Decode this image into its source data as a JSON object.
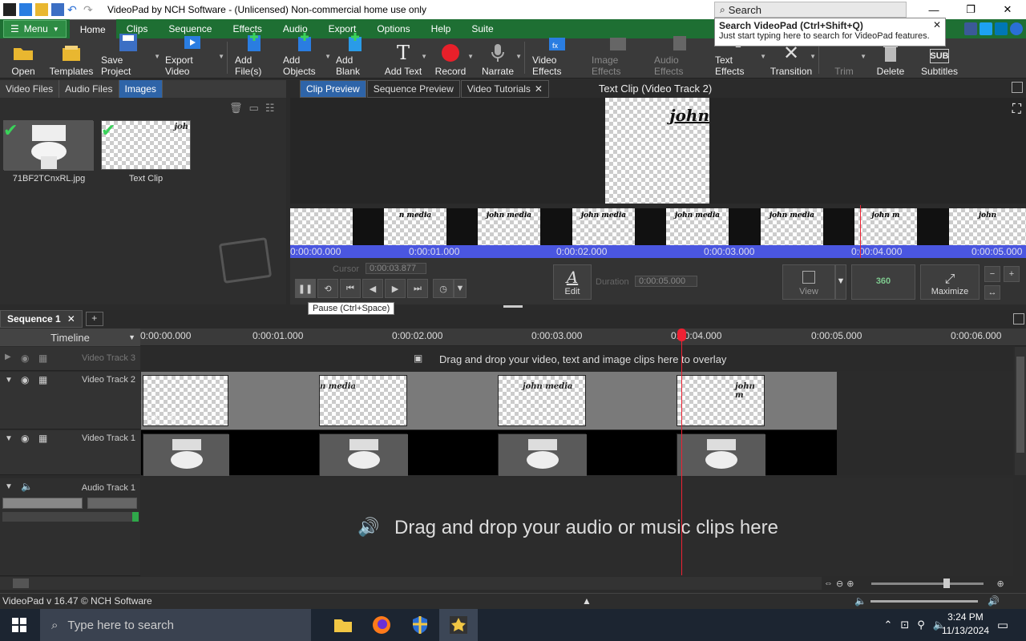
{
  "window": {
    "title": "VideoPad by NCH Software - (Unlicensed) Non-commercial home use only"
  },
  "search": {
    "label": "Search",
    "tip_title": "Search VideoPad (Ctrl+Shift+Q)",
    "tip_text": "Just start typing here to search for VideoPad features."
  },
  "menu": {
    "menu_label": "Menu",
    "tabs": [
      "Home",
      "Clips",
      "Sequence",
      "Effects",
      "Audio",
      "Export",
      "Options",
      "Help",
      "Suite"
    ]
  },
  "ribbon": {
    "open": "Open",
    "templates": "Templates",
    "save_project": "Save Project",
    "export_video": "Export Video",
    "add_files": "Add File(s)",
    "add_objects": "Add Objects",
    "add_blank": "Add Blank",
    "add_text": "Add Text",
    "record": "Record",
    "narrate": "Narrate",
    "video_effects": "Video Effects",
    "image_effects": "Image Effects",
    "audio_effects": "Audio Effects",
    "text_effects": "Text Effects",
    "transition": "Transition",
    "trim": "Trim",
    "delete": "Delete",
    "subtitles": "Subtitles"
  },
  "bins": {
    "tabs": [
      "Video Files",
      "Audio Files",
      "Images"
    ],
    "items": [
      {
        "label": "71BF2TCnxRL.jpg"
      },
      {
        "label": "Text Clip",
        "mini_text": "joh"
      }
    ]
  },
  "preview": {
    "tabs": [
      "Clip Preview",
      "Sequence Preview",
      "Video Tutorials"
    ],
    "title": "Text Clip (Video Track 2)",
    "canvas_text": "john",
    "frame_text": [
      "n media",
      "john media",
      "john media",
      "john media",
      "john media",
      "john m",
      "john"
    ],
    "times": [
      "0:00:00.000",
      "0:00:01.000",
      "0:00:02.000",
      "0:00:03.000",
      "0:00:04.000",
      "0:00:05.000"
    ],
    "cursor_label": "Cursor",
    "cursor_value": "0:00:03.877",
    "duration_label": "Duration",
    "duration_value": "0:00:05.000",
    "edit_label": "Edit",
    "view_label": "View",
    "btn_360": "360",
    "maximize_label": "Maximize",
    "tooltip": "Pause (Ctrl+Space)"
  },
  "sequence": {
    "tab": "Sequence 1",
    "timeline_label": "Timeline",
    "ruler": [
      "0:00:00.000",
      "0:00:01.000",
      "0:00:02.000",
      "0:00:03.000",
      "0:00:04.000",
      "0:00:05.000",
      "0:00:06.000"
    ],
    "tracks": {
      "v3": {
        "name": "Video Track 3",
        "hint": "Drag and drop your video, text and image clips here to overlay"
      },
      "v2": {
        "name": "Video Track 2",
        "clip_text": [
          "n media",
          "john media",
          "john m"
        ]
      },
      "v1": {
        "name": "Video Track 1"
      },
      "a1": {
        "name": "Audio Track 1",
        "hint": "Drag and drop your audio or music clips here"
      }
    }
  },
  "status": {
    "text": "VideoPad v 16.47 © NCH Software"
  },
  "taskbar": {
    "search_placeholder": "Type here to search",
    "time": "3:24 PM",
    "date": "11/13/2024"
  }
}
